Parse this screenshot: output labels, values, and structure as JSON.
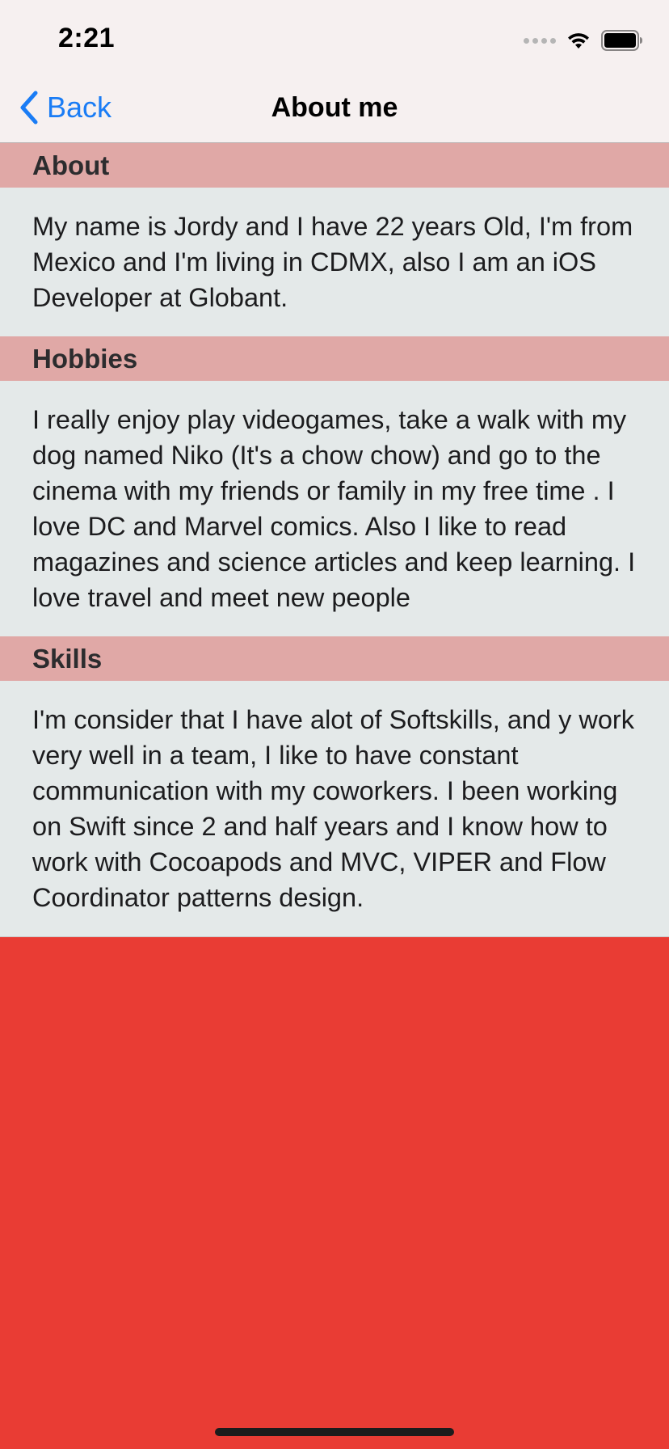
{
  "status_bar": {
    "time": "2:21"
  },
  "nav": {
    "back_label": "Back",
    "title": "About me"
  },
  "sections": [
    {
      "header": "About",
      "body": "My name is Jordy and I have 22 years Old, I'm from Mexico and I'm living in CDMX, also I am an iOS Developer at Globant."
    },
    {
      "header": "Hobbies",
      "body": "I really enjoy play videogames, take a walk with my dog named Niko (It's a chow chow) and go to the cinema with my friends or family in my free time . I love DC and Marvel comics. Also I like to read magazines and science articles and keep learning. I love travel and meet new people"
    },
    {
      "header": "Skills",
      "body": "I'm consider that I have alot of Softskills, and y work very well in a team, I like to have constant communication with my coworkers. I been working on Swift since 2 and half years and I know how to work with Cocoapods and MVC, VIPER and Flow Coordinator patterns design."
    }
  ],
  "colors": {
    "background": "#e93c34",
    "section_header": "#e0a8a6",
    "section_body": "#e4e9e9",
    "nav_bar": "#f6f0f0",
    "accent": "#1a7cf5"
  },
  "icons": {
    "back": "chevron-left-icon",
    "signal": "cellular-signal-icon",
    "wifi": "wifi-icon",
    "battery": "battery-icon"
  }
}
